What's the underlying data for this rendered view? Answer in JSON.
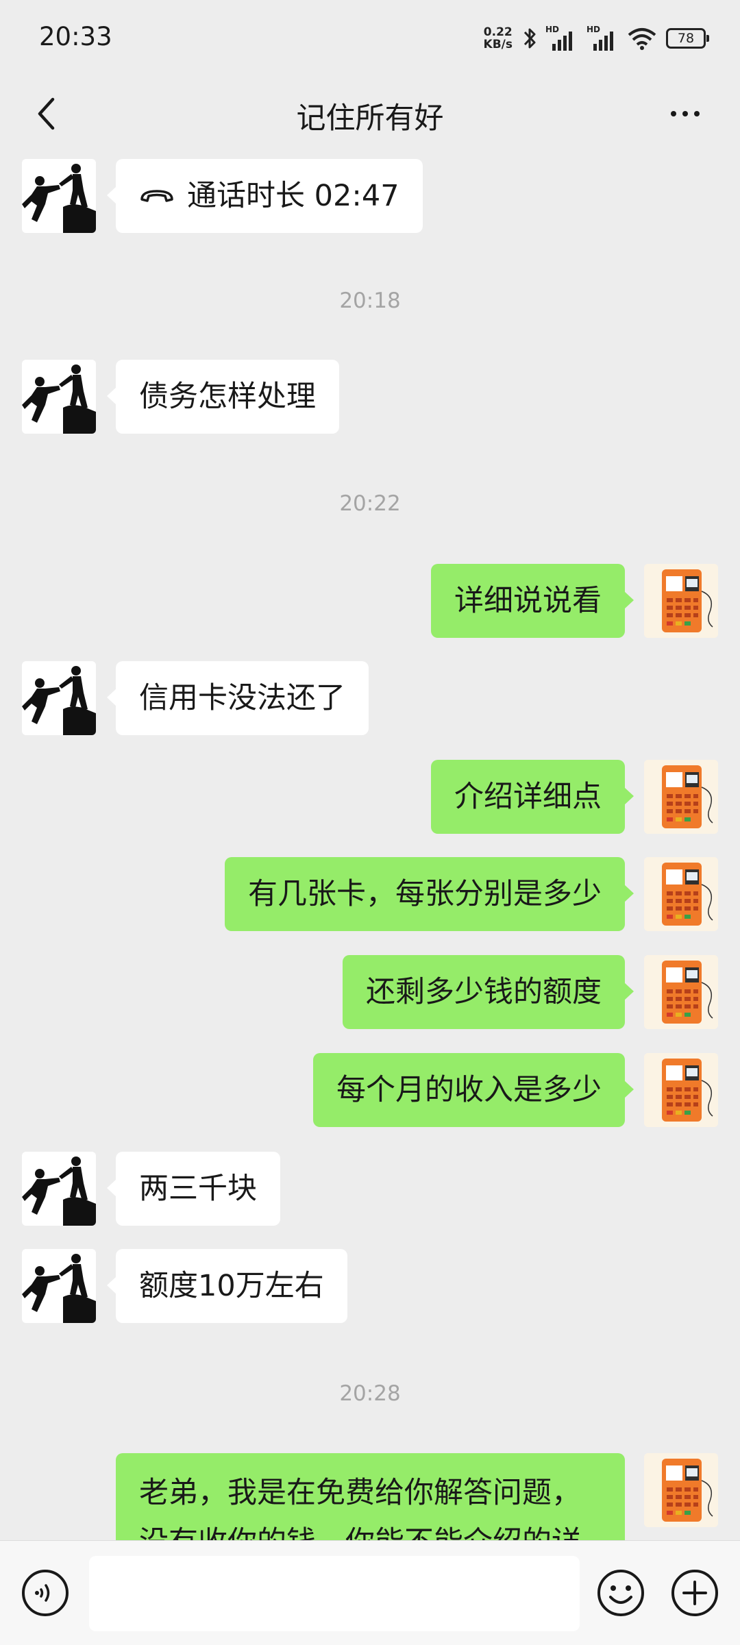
{
  "status_bar": {
    "time": "20:33",
    "net_speed_value": "0.22",
    "net_speed_unit": "KB/s",
    "signal1_label": "HD",
    "signal2_label": "HD",
    "battery": "78"
  },
  "header": {
    "title": "记住所有好"
  },
  "messages": [
    {
      "type": "in",
      "text": "通话时长 02:47",
      "icon": "phone-hangup-icon"
    },
    {
      "type": "time",
      "text": "20:18"
    },
    {
      "type": "in",
      "text": "债务怎样处理"
    },
    {
      "type": "time",
      "text": "20:22"
    },
    {
      "type": "out",
      "text": "详细说说看"
    },
    {
      "type": "in",
      "text": "信用卡没法还了"
    },
    {
      "type": "out",
      "text": "介绍详细点"
    },
    {
      "type": "out",
      "text": "有几张卡，每张分别是多少"
    },
    {
      "type": "out",
      "text": "还剩多少钱的额度"
    },
    {
      "type": "out",
      "text": "每个月的收入是多少"
    },
    {
      "type": "in",
      "text": "两三千块"
    },
    {
      "type": "in",
      "text": "额度10万左右"
    },
    {
      "type": "time",
      "text": "20:28"
    },
    {
      "type": "out",
      "text": "老弟，我是在免费给你解答问题，没有收你的钱，你能不能介绍的详"
    }
  ],
  "colors": {
    "background": "#ededed",
    "outgoing_bubble": "#95ec69",
    "incoming_bubble": "#ffffff"
  }
}
